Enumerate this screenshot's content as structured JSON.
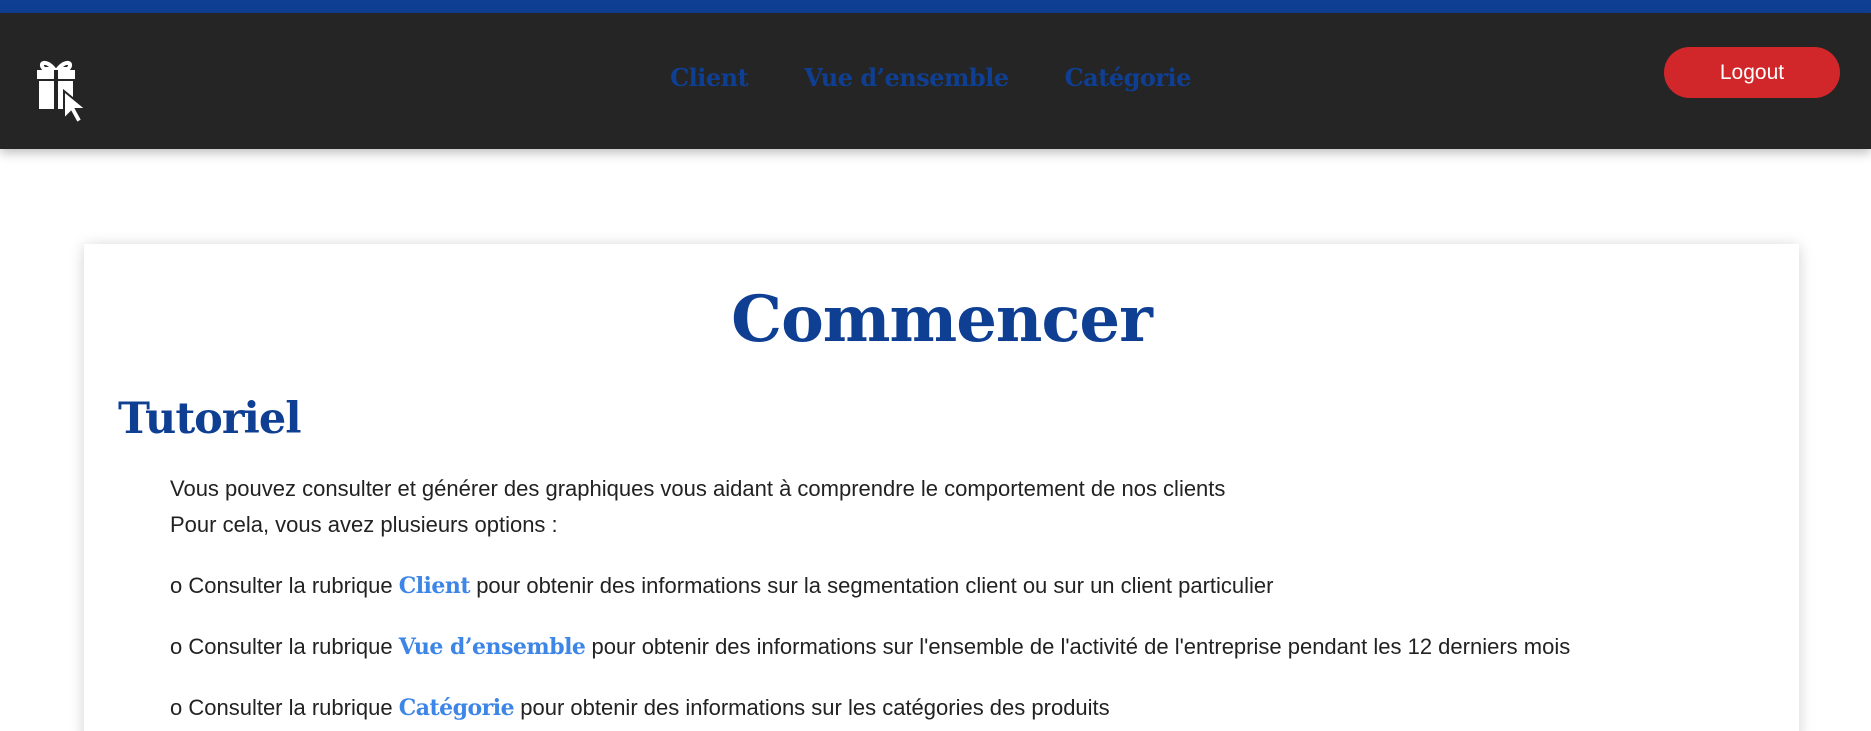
{
  "header": {
    "logo_icon": "gift-cursor-icon",
    "nav": [
      "Client",
      "Vue d’ensemble",
      "Catégorie"
    ],
    "logout_label": "Logout"
  },
  "colors": {
    "brand_blue": "#0f3f93",
    "link_blue": "#3d85e6",
    "navbar_bg": "#252525",
    "logout_red": "#d2272a"
  },
  "main": {
    "title": "Commencer",
    "subtitle": "Tutoriel",
    "intro_line1": "Vous pouvez consulter et générer des graphiques vous aidant à comprendre le comportement de nos clients",
    "intro_line2": "Pour cela, vous avez plusieurs options :",
    "options": [
      {
        "prefix": "o Consulter la rubrique ",
        "link": "Client",
        "suffix": " pour obtenir des informations sur la segmentation client ou sur un client particulier"
      },
      {
        "prefix": "o Consulter la rubrique ",
        "link": "Vue d’ensemble",
        "suffix": " pour obtenir des informations sur l'ensemble de l'activité de l'entreprise pendant les 12 derniers mois"
      },
      {
        "prefix": "o Consulter la rubrique ",
        "link": "Catégorie",
        "suffix": " pour obtenir des informations sur les catégories des produits"
      }
    ]
  }
}
